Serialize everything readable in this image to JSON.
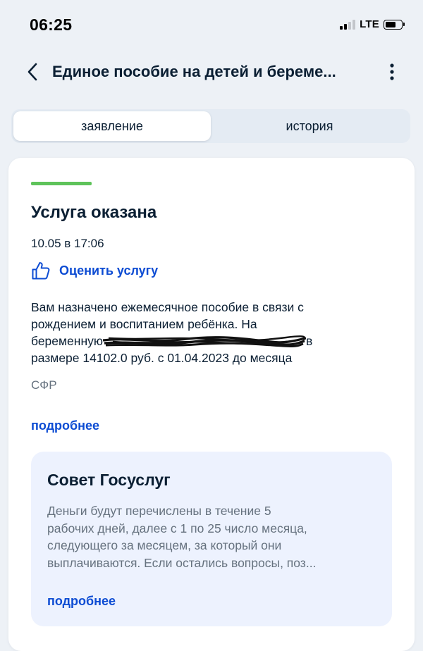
{
  "status_bar": {
    "time": "06:25",
    "network": "LTE"
  },
  "header": {
    "title": "Единое пособие на детей и береме..."
  },
  "tabs": [
    {
      "label": "заявление",
      "active": true
    },
    {
      "label": "история",
      "active": false
    }
  ],
  "card": {
    "status": "Услуга оказана",
    "status_color": "#5ec35a",
    "date": "10.05 в 17:06",
    "rate_label": "Оценить услугу",
    "message_lines": [
      "Вам назначено ежемесячное пособие в связи с",
      "рождением и воспитанием ребёнка. На",
      "беременную",
      "размере 14102.0 руб. с 01.04.2023 до месяца"
    ],
    "message_suffix": "в",
    "provider": "СФР",
    "more_link": "подробнее"
  },
  "tip": {
    "title": "Совет Госуслуг",
    "lines": [
      "Деньги будут перечислены в течение 5",
      "рабочих дней, далее с 1 по 25 число месяца,",
      "следующего за месяцем, за который они",
      "выплачиваются. Если остались вопросы, поз..."
    ],
    "more_link": "подробнее"
  },
  "colors": {
    "accent": "#0d4cd3",
    "text": "#0b1f33",
    "secondary_text": "#66727f",
    "background": "#edf1f6",
    "tip_background": "#edf2fe"
  }
}
